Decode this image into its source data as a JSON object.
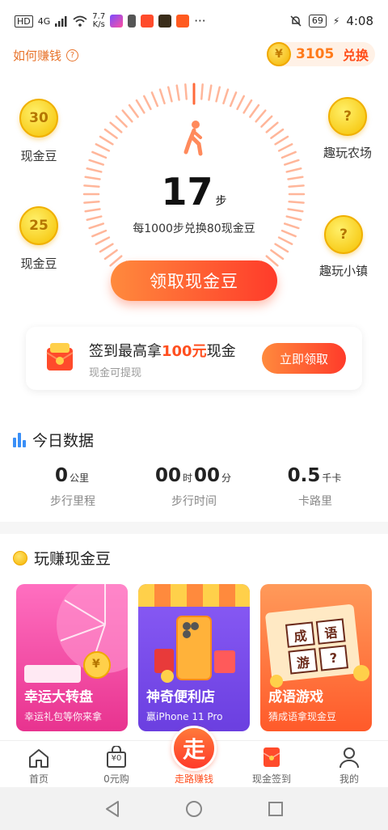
{
  "status_bar": {
    "left_tags": [
      "HD",
      "4G"
    ],
    "net_speed": "7.7",
    "net_unit": "K/s",
    "more": "···",
    "battery": "69",
    "time": "4:08"
  },
  "header": {
    "how_to_earn": "如何赚钱",
    "help_icon": "?",
    "coin_symbol": "¥",
    "coin_count": "3105",
    "exchange_label": "兑换"
  },
  "side_bubbles": [
    {
      "value": "30",
      "label": "现金豆"
    },
    {
      "value": "25",
      "label": "现金豆"
    },
    {
      "value": "?",
      "label": "趣玩农场"
    },
    {
      "value": "?",
      "label": "趣玩小镇"
    }
  ],
  "pedometer": {
    "steps": "17",
    "steps_unit": "步",
    "rate_text": "每1000步兑换80现金豆",
    "claim_button": "领取现金豆"
  },
  "signin_card": {
    "title_prefix": "签到最高拿",
    "title_highlight": "100元",
    "title_suffix": "现金",
    "subtitle": "现金可提现",
    "button": "立即领取"
  },
  "today": {
    "title": "今日数据",
    "stats": [
      {
        "value": "0",
        "unit": "公里",
        "label": "步行里程"
      },
      {
        "hours": "00",
        "hours_unit": "时",
        "minutes": "00",
        "minutes_unit": "分",
        "label": "步行时间"
      },
      {
        "value": "0.5",
        "unit": "千卡",
        "label": "卡路里"
      }
    ]
  },
  "games": {
    "title": "玩赚现金豆",
    "cards": [
      {
        "title": "幸运大转盘",
        "subtitle": "幸运礼包等你来拿",
        "color_top": "#ff5fb0",
        "color_bottom": "#e8338f"
      },
      {
        "title": "神奇便利店",
        "subtitle": "赢iPhone 11 Pro",
        "color_top": "#8a5cf6",
        "color_bottom": "#6b3fe0"
      },
      {
        "title": "成语游戏",
        "subtitle": "猜成语拿现金豆",
        "color_top": "#ff8a4a",
        "color_bottom": "#ff5a2a"
      }
    ],
    "card_texts": {
      "coin_char": "¥",
      "idiom_chars": [
        "成",
        "语",
        "游",
        "?"
      ]
    }
  },
  "bottom_nav": {
    "items": [
      {
        "label": "首页",
        "icon": "home-icon"
      },
      {
        "label": "0元购",
        "icon": "bag-icon",
        "icon_text": "¥0"
      },
      {
        "label": "走路赚钱",
        "icon": "walk-money-icon",
        "icon_text": "走"
      },
      {
        "label": "现金签到",
        "icon": "redpacket-icon"
      },
      {
        "label": "我的",
        "icon": "profile-icon"
      }
    ],
    "active_color": "#ff4f1f"
  },
  "colors": {
    "accent": "#ff4f1f",
    "orange": "#ff8a3d",
    "coin": "#f4b400"
  }
}
